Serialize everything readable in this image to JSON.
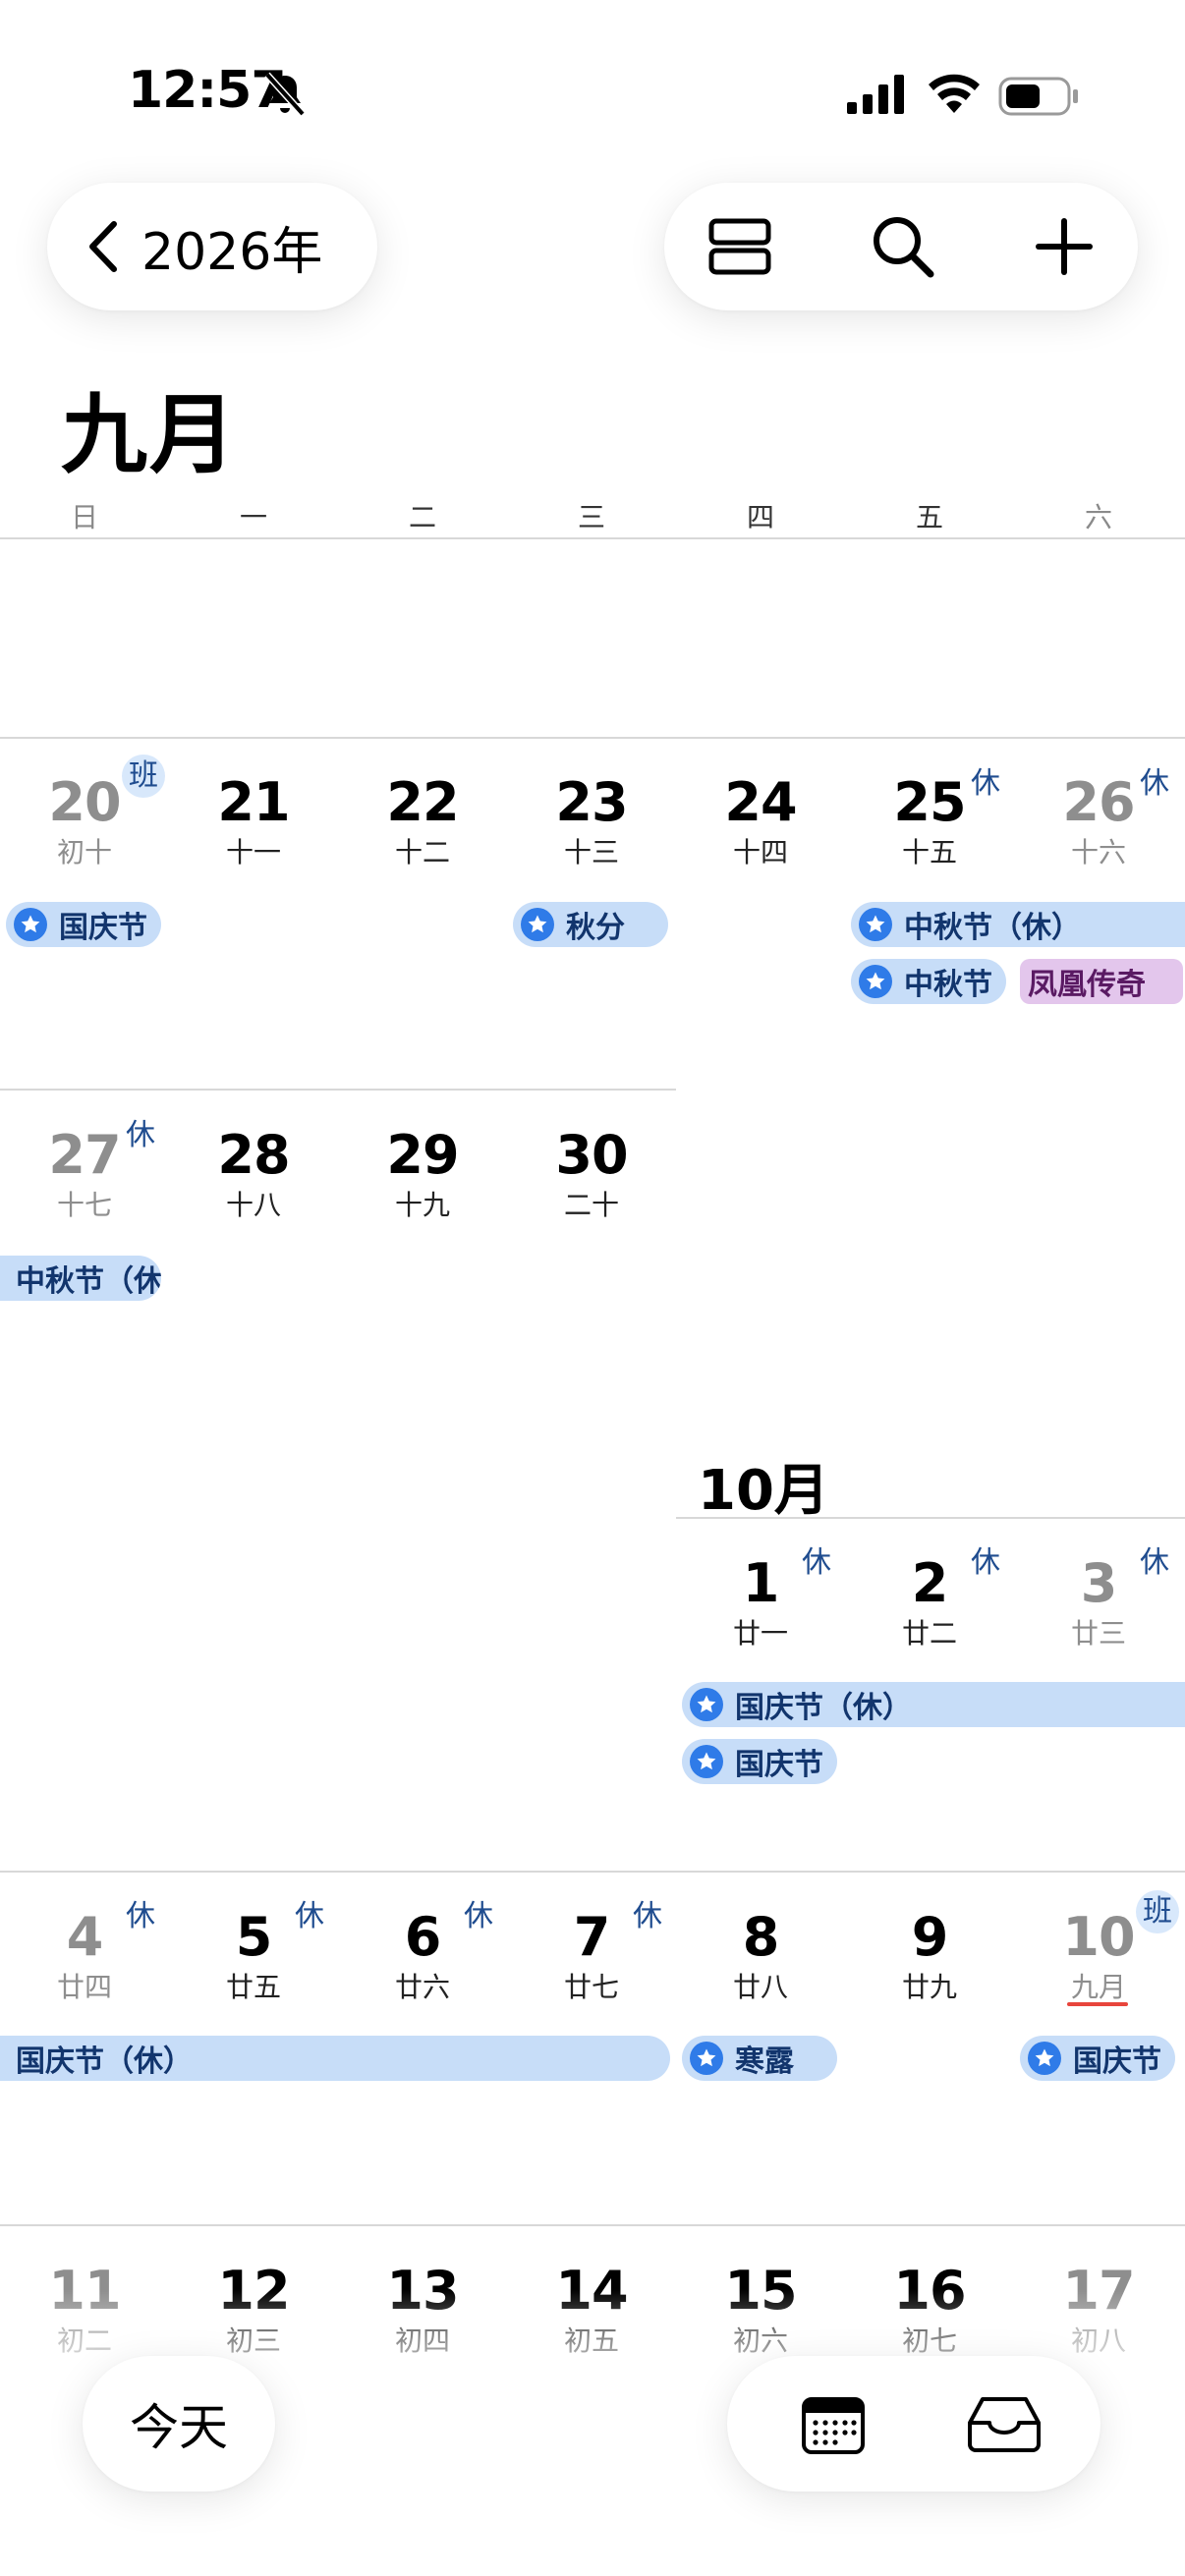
{
  "status_bar": {
    "time": "12:57"
  },
  "nav": {
    "back_label": "2026年"
  },
  "month_title": "九月",
  "weekdays": [
    "日",
    "一",
    "二",
    "三",
    "四",
    "五",
    "六"
  ],
  "week1": {
    "days": [
      {
        "num": "20",
        "lunar": "初十",
        "badge": "班"
      },
      {
        "num": "21",
        "lunar": "十一"
      },
      {
        "num": "22",
        "lunar": "十二"
      },
      {
        "num": "23",
        "lunar": "十三"
      },
      {
        "num": "24",
        "lunar": "十四"
      },
      {
        "num": "25",
        "lunar": "十五",
        "badge": "休"
      },
      {
        "num": "26",
        "lunar": "十六",
        "badge": "休"
      }
    ],
    "events": {
      "guoqing": "国庆节",
      "qiufen": "秋分",
      "zhongqiu_holiday": "中秋节（休）",
      "zhongqiu": "中秋节",
      "fenghuang": "凤凰传奇"
    }
  },
  "week2": {
    "days": [
      {
        "num": "27",
        "lunar": "十七",
        "badge": "休"
      },
      {
        "num": "28",
        "lunar": "十八"
      },
      {
        "num": "29",
        "lunar": "十九"
      },
      {
        "num": "30",
        "lunar": "二十"
      }
    ],
    "events": {
      "zhongqiu_cont": "中秋节（休"
    }
  },
  "october_title": "10月",
  "oct_week1": {
    "days": [
      {
        "num": "1",
        "lunar": "廿一",
        "badge": "休"
      },
      {
        "num": "2",
        "lunar": "廿二",
        "badge": "休"
      },
      {
        "num": "3",
        "lunar": "廿三",
        "badge": "休"
      }
    ],
    "events": {
      "guoqing_holiday": "国庆节（休）",
      "guoqing": "国庆节"
    }
  },
  "oct_week2": {
    "days": [
      {
        "num": "4",
        "lunar": "廿四",
        "badge": "休"
      },
      {
        "num": "5",
        "lunar": "廿五",
        "badge": "休"
      },
      {
        "num": "6",
        "lunar": "廿六",
        "badge": "休"
      },
      {
        "num": "7",
        "lunar": "廿七",
        "badge": "休"
      },
      {
        "num": "8",
        "lunar": "廿八"
      },
      {
        "num": "9",
        "lunar": "廿九"
      },
      {
        "num": "10",
        "lunar": "九月",
        "badge": "班"
      }
    ],
    "events": {
      "guoqing_holiday": "国庆节（休）",
      "hanlu": "寒露",
      "guoqing": "国庆节"
    }
  },
  "oct_week3": {
    "days": [
      {
        "num": "11",
        "lunar": "初二"
      },
      {
        "num": "12",
        "lunar": "初三"
      },
      {
        "num": "13",
        "lunar": "初四"
      },
      {
        "num": "14",
        "lunar": "初五"
      },
      {
        "num": "15",
        "lunar": "初六"
      },
      {
        "num": "16",
        "lunar": "初七"
      },
      {
        "num": "17",
        "lunar": "初八"
      }
    ]
  },
  "bottom": {
    "today_label": "今天"
  },
  "colors": {
    "accent": "#2f7be8",
    "chip_bg": "#c7ddf8",
    "badge_text": "#1f4c8f",
    "purple_chip": "#e3c6ec",
    "today_underline": "#e8453c"
  }
}
